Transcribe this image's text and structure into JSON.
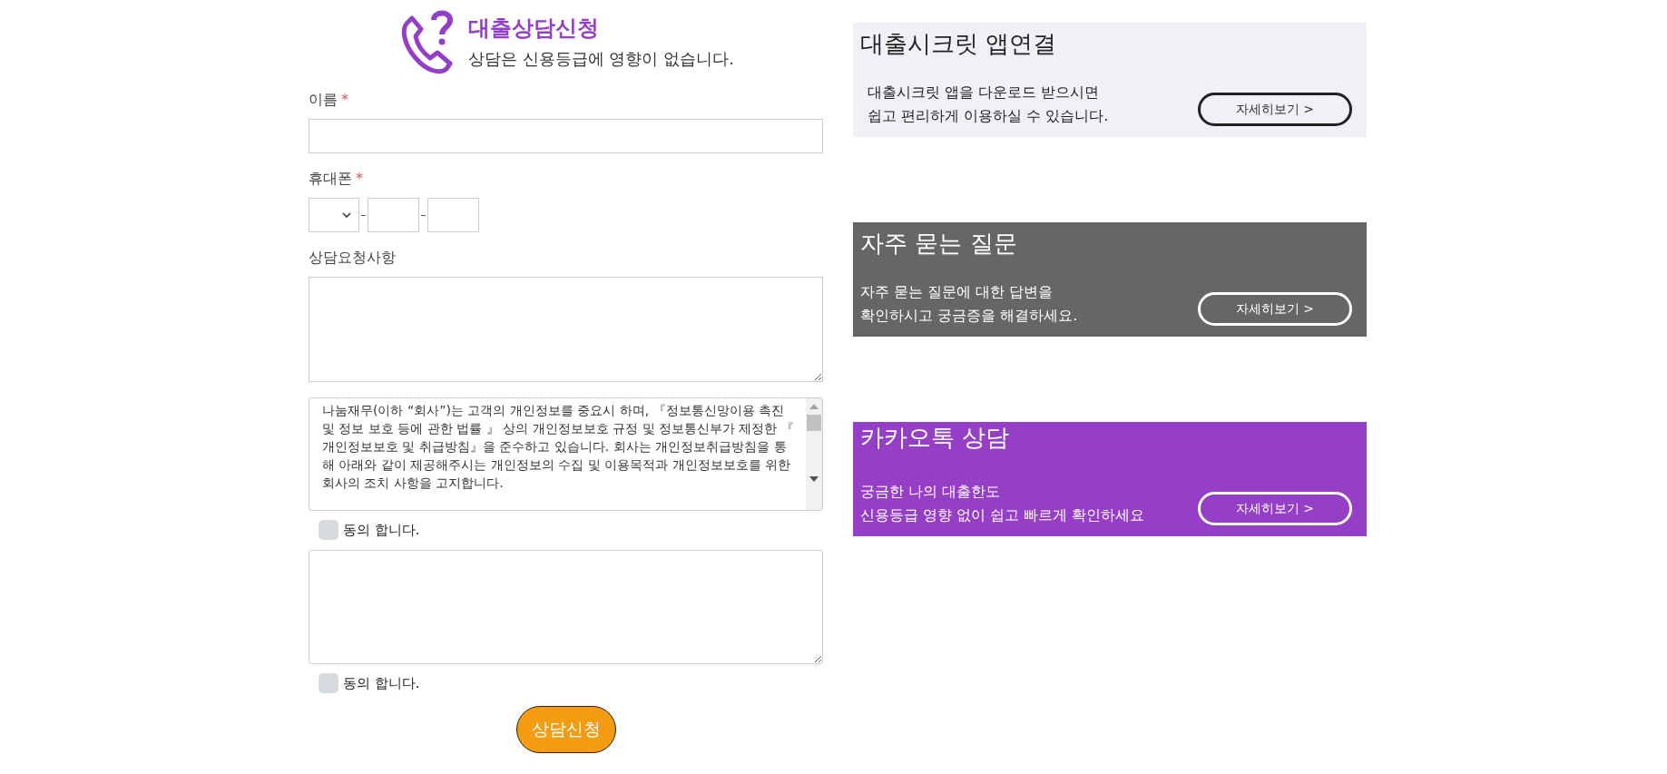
{
  "header": {
    "title": "대출상담신청",
    "subtitle": "상담은 신용등급에 영향이 없습니다."
  },
  "form": {
    "fields": [
      {
        "kind": "text",
        "label": "이름",
        "required_mark": "*"
      },
      {
        "kind": "phone",
        "label": "휴대폰",
        "required_mark": "*"
      },
      {
        "kind": "textarea",
        "label": "상담요청사항"
      }
    ],
    "agreements": [
      {
        "terms": "나눔재무(이하 “회사”)는 고객의 개인정보를 중요시 하며, 『정보통신망이용 촉진 및 정보 보호 등에 관한 법률 』 상의 개인정보보호 규정 및 정보통신부가 제정한 『 개인정보보호 및 취급방침』을 준수하고 있습니다. 회사는 개인정보취급방침을 통해 아래와 같이 제공해주시는 개인정보의 수집 및 이용목적과 개인정보보호를 위한 회사의 조치 사항을 고지합니다.",
        "label": "동의 합니다.",
        "checked": false
      },
      {
        "label": "동의 합니다.",
        "checked": false
      }
    ],
    "submit": "상담신청"
  },
  "cards": [
    {
      "kind": "light",
      "title": "대출시크릿 앱연결",
      "text": "대출시크릿 앱을 다운로드 받으시면\n쉽고 편리하게 이용하실 수 있습니다.",
      "button": "자세히보기 >"
    },
    {
      "kind": "dark",
      "title": "자주 묻는 질문",
      "text": "자주 묻는 질문에 대한 답변을\n확인하시고 궁금증을 해결하세요.",
      "button": "자세히보기 >"
    },
    {
      "kind": "purple",
      "title": "카카오톡 상담",
      "text": "궁금한 나의 대출한도\n신용등급 영향 없이 쉽고 빠르게 확인하세요",
      "button": "자세히보기 >"
    }
  ]
}
